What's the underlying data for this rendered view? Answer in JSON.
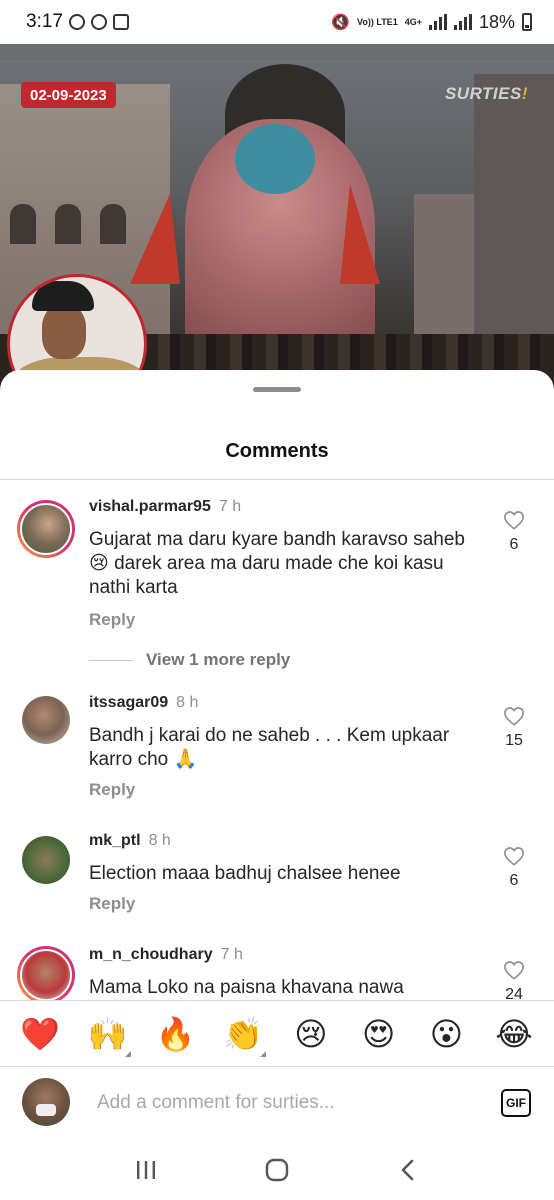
{
  "status_bar": {
    "time": "3:17",
    "network": "4G+",
    "volte": "Vo)) LTE1",
    "battery": "18%",
    "icons": [
      "whatsapp-icon",
      "b-app-icon",
      "gallery-icon",
      "mute-icon",
      "signal-icon",
      "battery-icon"
    ]
  },
  "post": {
    "date_badge": "02-09-2023",
    "brand_logo": "SURTIES",
    "colors": {
      "badge": "#c1272d",
      "logo_accent": "#f2c230"
    }
  },
  "sheet": {
    "title": "Comments"
  },
  "comments": [
    {
      "username": "vishal.parmar95",
      "time": "7 h",
      "text": "Gujarat ma daru kyare bandh karavso saheb 😢 darek area ma daru made che koi kasu nathi karta",
      "reply_label": "Reply",
      "likes": "6",
      "has_story_ring": true,
      "view_more": "View 1 more reply"
    },
    {
      "username": "itssagar09",
      "time": "8 h",
      "text": "Bandh j karai do ne saheb . . . Kem upkaar karro cho 🙏",
      "reply_label": "Reply",
      "likes": "15",
      "has_story_ring": false
    },
    {
      "username": "mk_ptl",
      "time": "8 h",
      "text": "Election maaa badhuj chalsee henee",
      "reply_label": "Reply",
      "likes": "6",
      "has_story_ring": false
    },
    {
      "username": "m_n_choudhary",
      "time": "7 h",
      "text": "Mama Loko na paisna khavana nawa",
      "likes": "24",
      "has_story_ring": true
    }
  ],
  "emoji_bar": [
    "❤️",
    "🙌",
    "🔥",
    "👏",
    "😢",
    "😍",
    "😮",
    "😂"
  ],
  "input": {
    "placeholder": "Add a comment for surties...",
    "gif_label": "GIF"
  },
  "nav": [
    "recent-apps-icon",
    "home-icon",
    "back-icon"
  ]
}
